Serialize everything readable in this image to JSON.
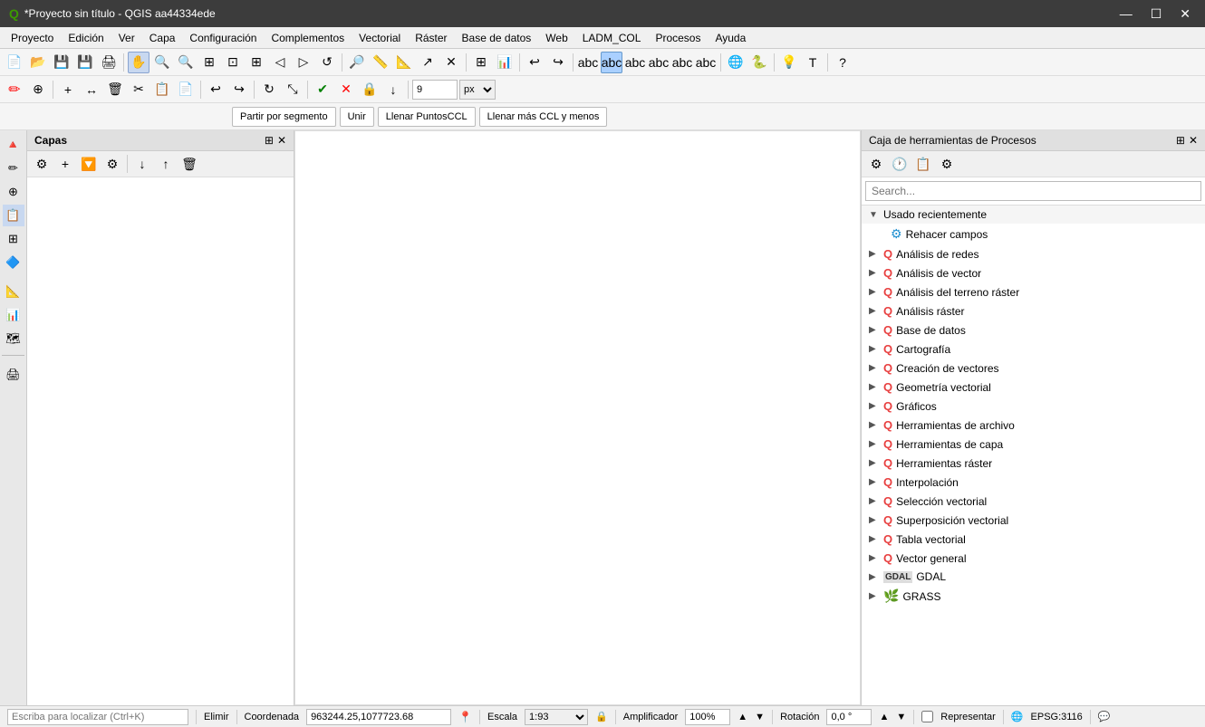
{
  "titlebar": {
    "logo": "Q",
    "title": "*Proyecto sin título - QGIS aa44334ede",
    "min": "—",
    "max": "☐",
    "close": "✕"
  },
  "menubar": {
    "items": [
      "Proyecto",
      "Edición",
      "Ver",
      "Capa",
      "Configuración",
      "Complementos",
      "Vectorial",
      "Ráster",
      "Base de datos",
      "Web",
      "LADM_COL",
      "Procesos",
      "Ayuda"
    ]
  },
  "layers_panel": {
    "title": "Capas"
  },
  "snap_toolbar": {
    "buttons": [
      "Partir por segmento",
      "Unir",
      "Llenar PuntosCCL",
      "Llenar más CCL y menos"
    ]
  },
  "proc_panel": {
    "title": "Caja de herramientas de Procesos",
    "search_placeholder": "Search...",
    "tree": [
      {
        "type": "parent",
        "expanded": true,
        "icon": "▼",
        "label": "Usado recientemente",
        "children": [
          {
            "icon": "⚙",
            "icon_color": "#2090d0",
            "label": "Rehacer campos"
          }
        ]
      },
      {
        "type": "group",
        "icon": "▶",
        "q_icon": true,
        "label": "Análisis de redes"
      },
      {
        "type": "group",
        "icon": "▶",
        "q_icon": true,
        "label": "Análisis de vector"
      },
      {
        "type": "group",
        "icon": "▶",
        "q_icon": true,
        "label": "Análisis del terreno ráster"
      },
      {
        "type": "group",
        "icon": "▶",
        "q_icon": true,
        "label": "Análisis ráster"
      },
      {
        "type": "group",
        "icon": "▶",
        "q_icon": true,
        "label": "Base de datos"
      },
      {
        "type": "group",
        "icon": "▶",
        "q_icon": true,
        "label": "Cartografía"
      },
      {
        "type": "group",
        "icon": "▶",
        "q_icon": true,
        "label": "Creación de vectores"
      },
      {
        "type": "group",
        "icon": "▶",
        "q_icon": true,
        "label": "Geometría vectorial"
      },
      {
        "type": "group",
        "icon": "▶",
        "q_icon": true,
        "label": "Gráficos"
      },
      {
        "type": "group",
        "icon": "▶",
        "q_icon": true,
        "label": "Herramientas de archivo"
      },
      {
        "type": "group",
        "icon": "▶",
        "q_icon": true,
        "label": "Herramientas de capa"
      },
      {
        "type": "group",
        "icon": "▶",
        "q_icon": true,
        "label": "Herramientas ráster"
      },
      {
        "type": "group",
        "icon": "▶",
        "q_icon": true,
        "label": "Interpolación"
      },
      {
        "type": "group",
        "icon": "▶",
        "q_icon": true,
        "label": "Selección vectorial"
      },
      {
        "type": "group",
        "icon": "▶",
        "q_icon": true,
        "label": "Superposición vectorial"
      },
      {
        "type": "group",
        "icon": "▶",
        "q_icon": true,
        "label": "Tabla vectorial"
      },
      {
        "type": "group",
        "icon": "▶",
        "q_icon": true,
        "label": "Vector general"
      },
      {
        "type": "group",
        "icon": "▶",
        "gdal_icon": true,
        "label": "GDAL"
      },
      {
        "type": "group",
        "icon": "▶",
        "grass_icon": true,
        "label": "GRASS"
      }
    ]
  },
  "statusbar": {
    "localize_placeholder": "Escriba para localizar (Ctrl+K)",
    "eliminar": "Elimir",
    "coordenada_label": "Coordenada",
    "coordenada_value": "963244.25,1077723.68",
    "escala_label": "Escala",
    "escala_value": "1:93",
    "amplificador_label": "Amplificador",
    "amplificador_value": "100%",
    "rotacion_label": "Rotación",
    "rotacion_value": "0,0 °",
    "representar_label": "Representar",
    "epsg_label": "EPSG:3116"
  },
  "digitize": {
    "px_value": "9",
    "unit_value": "px"
  },
  "icons": {
    "q_green": "🟢",
    "gear": "⚙",
    "settings": "⚙",
    "arrow_down": "▼",
    "arrow_right": "▶",
    "lock": "🔒",
    "globe": "🌐"
  }
}
